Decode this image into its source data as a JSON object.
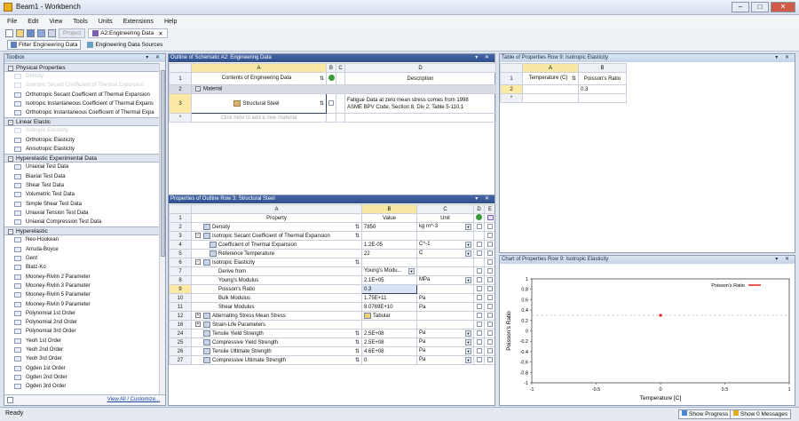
{
  "app": {
    "title": "Beam1 - Workbench"
  },
  "menu": [
    "File",
    "Edit",
    "View",
    "Tools",
    "Units",
    "Extensions",
    "Help"
  ],
  "toolbar": {
    "project_tab": "Project",
    "eng_tab": "A2:Engineering Data"
  },
  "toolbar2": {
    "filter_label": "Filter Engineering Data",
    "sources_label": "Engineering Data Sources"
  },
  "toolbox": {
    "title": "Toolbox",
    "categories": [
      {
        "label": "Physical Properties",
        "items": [
          "Density",
          "Isotropic Secant Coefficient of Thermal Expansion",
          "Orthotropic Secant Coefficient of Thermal Expansion",
          "Isotropic Instantaneous Coefficient of Thermal Expans",
          "Orthotropic Instantaneous Coefficient of Thermal Expa"
        ],
        "faded": [
          0,
          1
        ]
      },
      {
        "label": "Linear Elastic",
        "items": [
          "Isotropic Elasticity",
          "Orthotropic Elasticity",
          "Anisotropic Elasticity"
        ],
        "faded": [
          0
        ]
      },
      {
        "label": "Hyperelastic Experimental Data",
        "items": [
          "Uniaxial Test Data",
          "Biaxial Test Data",
          "Shear Test Data",
          "Volumetric Test Data",
          "Simple Shear Test Data",
          "Uniaxial Tension Test Data",
          "Uniaxial Compression Test Data"
        ],
        "faded": []
      },
      {
        "label": "Hyperelastic",
        "items": [
          "Neo-Hookean",
          "Arruda-Boyce",
          "Gent",
          "Blatz-Ko",
          "Mooney-Rivlin 2 Parameter",
          "Mooney-Rivlin 3 Parameter",
          "Mooney-Rivlin 5 Parameter",
          "Mooney-Rivlin 9 Parameter",
          "Polynomial 1st Order",
          "Polynomial 2nd Order",
          "Polynomial 3rd Order",
          "Yeoh 1st Order",
          "Yeoh 2nd Order",
          "Yeoh 3rd Order",
          "Ogden 1st Order",
          "Ogden 2nd Order",
          "Ogden 3rd Order"
        ],
        "faded": []
      }
    ],
    "view_all": "View All / Customize..."
  },
  "outline": {
    "title": "Outline of Schematic A2: Engineering Data",
    "cols": [
      "A",
      "B",
      "C",
      "D"
    ],
    "headers": {
      "a": "Contents of Engineering Data",
      "d": "Description"
    },
    "rows": [
      {
        "n": "1"
      },
      {
        "n": "2",
        "a": "Material"
      },
      {
        "n": "3",
        "a": "Structural Steel",
        "d1": "Fatigue Data at zero mean stress comes from 1998",
        "d2": "ASME BPV Code, Section 8, Div 2, Table 5-110.1"
      },
      {
        "n": "*",
        "a": "Click here to add a new material"
      }
    ]
  },
  "table9": {
    "title": "Table of Properties Row 9: Isotropic Elasticity",
    "cols": [
      "A",
      "B"
    ],
    "headers": [
      "Temperature (C)",
      "Poisson's Ratio"
    ],
    "rows": [
      {
        "n": "2",
        "a": "",
        "b": "0.3"
      },
      {
        "n": "*",
        "a": "",
        "b": ""
      }
    ]
  },
  "props": {
    "title": "Properties of Outline Row 3: Structural Steel",
    "cols": [
      "A",
      "B",
      "C",
      "D",
      "E"
    ],
    "headers": {
      "a": "Property",
      "b": "Value",
      "c": "Unit"
    },
    "rows": [
      {
        "n": "2",
        "lvl": 0,
        "pm": "",
        "label": "Density",
        "val": "7850",
        "unit": "kg m^-3",
        "dd": true
      },
      {
        "n": "3",
        "lvl": 0,
        "pm": "-",
        "label": "Isotropic Secant Coefficient of Thermal Expansion",
        "val": "",
        "unit": "",
        "dd": false
      },
      {
        "n": "4",
        "lvl": 1,
        "pm": "",
        "label": "Coefficient of Thermal Expansion",
        "val": "1.2E-05",
        "unit": "C^-1",
        "dd": true
      },
      {
        "n": "5",
        "lvl": 1,
        "pm": "",
        "label": "Reference Temperature",
        "val": "22",
        "unit": "C",
        "dd": true
      },
      {
        "n": "6",
        "lvl": 0,
        "pm": "-",
        "label": "Isotropic Elasticity",
        "val": "",
        "unit": "",
        "dd": false
      },
      {
        "n": "7",
        "lvl": 2,
        "pm": "",
        "label": "Derive from",
        "val": "Young's Modu...",
        "unit": "",
        "dd": false,
        "valdd": true
      },
      {
        "n": "8",
        "lvl": 2,
        "pm": "",
        "label": "Young's Modulus",
        "val": "2.1E+05",
        "unit": "MPa",
        "dd": true
      },
      {
        "n": "9",
        "lvl": 2,
        "pm": "",
        "label": "Poisson's Ratio",
        "val": "0.3",
        "unit": "",
        "dd": false,
        "selected": true
      },
      {
        "n": "10",
        "lvl": 2,
        "pm": "",
        "label": "Bulk Modulus",
        "val": "1.75E+11",
        "unit": "Pa",
        "dd": false
      },
      {
        "n": "11",
        "lvl": 2,
        "pm": "",
        "label": "Shear Modulus",
        "val": "8.0769E+10",
        "unit": "Pa",
        "dd": false
      },
      {
        "n": "12",
        "lvl": 0,
        "pm": "+",
        "label": "Alternating Stress Mean Stress",
        "val": "Tabular",
        "unit": "",
        "dd": false,
        "tab": true
      },
      {
        "n": "16",
        "lvl": 0,
        "pm": "+",
        "label": "Strain-Life Parameters",
        "val": "",
        "unit": "",
        "dd": false
      },
      {
        "n": "24",
        "lvl": 0,
        "pm": "",
        "label": "Tensile Yield Strength",
        "val": "2.5E+08",
        "unit": "Pa",
        "dd": true
      },
      {
        "n": "25",
        "lvl": 0,
        "pm": "",
        "label": "Compressive Yield Strength",
        "val": "2.5E+08",
        "unit": "Pa",
        "dd": true
      },
      {
        "n": "26",
        "lvl": 0,
        "pm": "",
        "label": "Tensile Ultimate Strength",
        "val": "4.6E+08",
        "unit": "Pa",
        "dd": true
      },
      {
        "n": "27",
        "lvl": 0,
        "pm": "",
        "label": "Compressive Ultimate Strength",
        "val": "0",
        "unit": "Pa",
        "dd": true
      }
    ]
  },
  "chart_panel": {
    "title": "Chart of Properties Row 9: Isotropic Elasticity"
  },
  "chart_data": {
    "type": "scatter",
    "series": [
      {
        "name": "Poisson's Ratio",
        "x": [
          0
        ],
        "y": [
          0.3
        ],
        "color": "#e0201c"
      }
    ],
    "xlabel": "Temperature [C]",
    "ylabel": "Poisson's Ratio",
    "xlim": [
      -1,
      1
    ],
    "ylim": [
      -1,
      1
    ],
    "xticks": [
      "-1",
      "-0.5",
      "0",
      "0.5",
      "1"
    ],
    "yticks": [
      "1",
      "0.8",
      "0.6",
      "0.4",
      "0.2",
      "0",
      "-0.2",
      "-0.4",
      "-0.6",
      "-0.8",
      "-1"
    ],
    "legend": "top-right"
  },
  "status": {
    "text": "Ready",
    "progress_btn": "Show Progress",
    "messages_btn": "Show 0 Messages"
  }
}
